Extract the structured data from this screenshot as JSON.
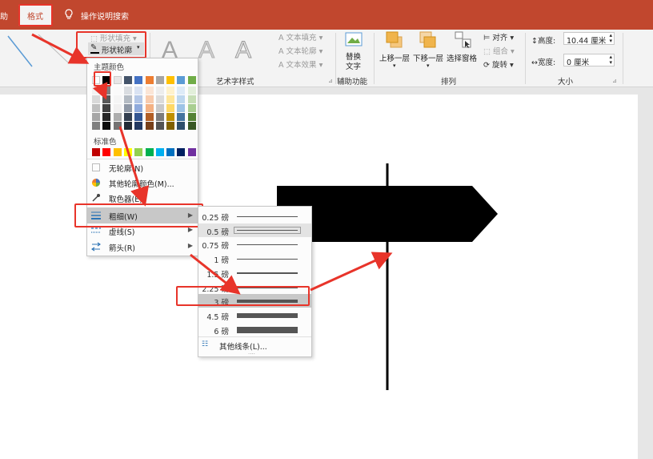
{
  "topbar": {
    "left_tab_fragment": "助",
    "active_tab": "格式",
    "tell_me": "操作说明搜索"
  },
  "ribbon": {
    "shape_fill": "形状填充",
    "shape_outline": "形状轮廓",
    "text_fill": "文本填充",
    "text_outline": "文本轮廓",
    "text_effect": "文本效果",
    "art_group": "艺术字样式",
    "alt_text": "替换文字",
    "alt_text_line1": "替换",
    "alt_text_line2": "文字",
    "accessibility_group": "辅助功能",
    "bring_forward": "上移一层",
    "send_backward": "下移一层",
    "selection_pane": "选择窗格",
    "align": "对齐",
    "group": "组合",
    "rotate": "旋转",
    "arrange_group": "排列",
    "height_label": "高度:",
    "height_value": "10.44 厘米",
    "width_label": "宽度:",
    "width_value": "0 厘米",
    "size_group": "大小"
  },
  "menu": {
    "theme_colors": "主题颜色",
    "standard_colors": "标准色",
    "no_outline": "无轮廓(N)",
    "more_colors": "其他轮廓颜色(M)...",
    "eyedropper": "取色器(E)",
    "weight": "粗细(W)",
    "dashes": "虚线(S)",
    "arrows": "箭头(R)"
  },
  "theme_colors": [
    "#ffffff",
    "#000000",
    "#e7e6e6",
    "#44546a",
    "#4472c4",
    "#ed7d31",
    "#a5a5a5",
    "#ffc000",
    "#5b9bd5",
    "#70ad47"
  ],
  "standard_colors": [
    "#c00000",
    "#ff0000",
    "#ffc000",
    "#ffff00",
    "#92d050",
    "#00b050",
    "#00b0f0",
    "#0070c0",
    "#002060",
    "#7030a0"
  ],
  "weights": [
    {
      "label": "0.25 磅",
      "pt": 0.25
    },
    {
      "label": "0.5 磅",
      "pt": 0.5
    },
    {
      "label": "0.75 磅",
      "pt": 0.75
    },
    {
      "label": "1 磅",
      "pt": 1
    },
    {
      "label": "1.5 磅",
      "pt": 1.5
    },
    {
      "label": "2.25 磅",
      "pt": 2.25
    },
    {
      "label": "3 磅",
      "pt": 3
    },
    {
      "label": "4.5 磅",
      "pt": 4.5
    },
    {
      "label": "6 磅",
      "pt": 6
    }
  ],
  "selected_weight": "3 磅",
  "more_lines": "其他线条(L)...",
  "colors": {
    "accent": "#c1472e",
    "highlight": "#e8342a",
    "arrow": "#e8342a"
  }
}
